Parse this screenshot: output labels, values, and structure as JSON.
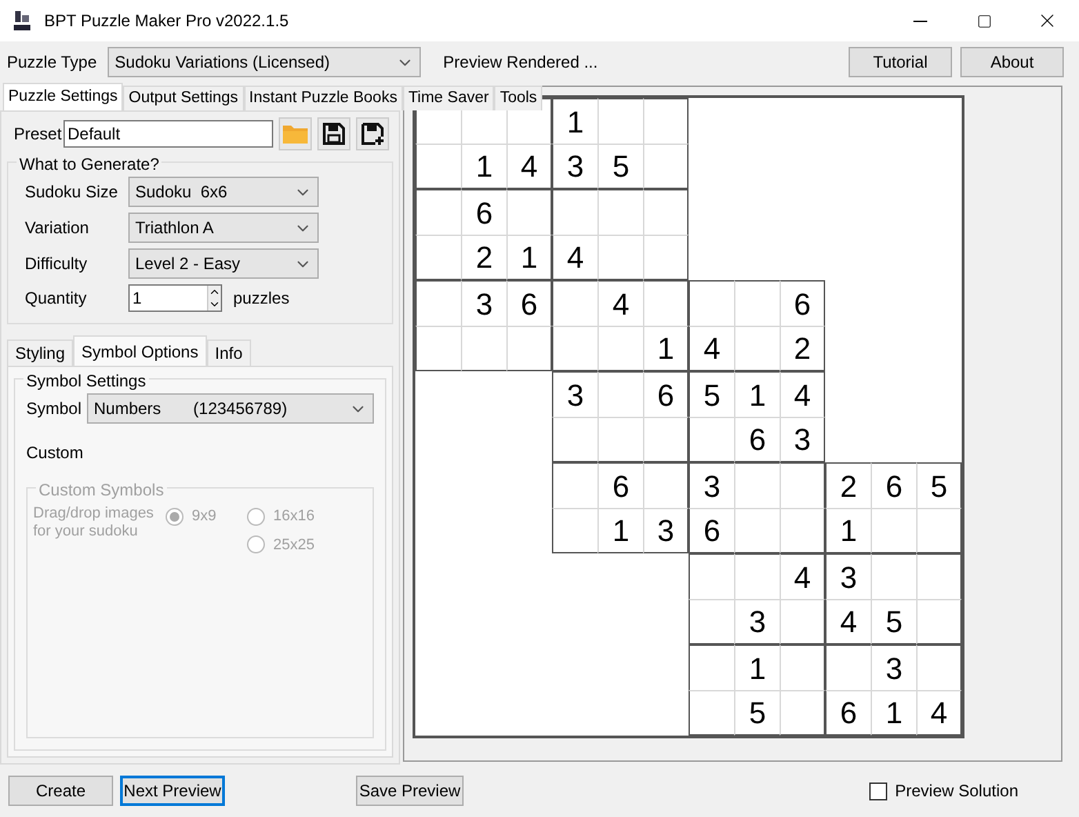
{
  "window": {
    "title": "BPT Puzzle Maker Pro v2022.1.5"
  },
  "toolbar": {
    "puzzle_type_label": "Puzzle Type",
    "puzzle_type": "Sudoku Variations (Licensed)",
    "status": "Preview Rendered ...",
    "buttons": [
      "Tutorial",
      "About"
    ]
  },
  "tabs": [
    {
      "label": "Puzzle Settings",
      "selected": true
    },
    {
      "label": "Output Settings",
      "selected": false
    },
    {
      "label": "Instant Puzzle Books",
      "selected": false
    },
    {
      "label": "Time Saver",
      "selected": false
    },
    {
      "label": "Tools",
      "selected": false
    }
  ],
  "preset": {
    "label": "Preset",
    "value": "Default"
  },
  "generate": {
    "title": "What to Generate?",
    "fields": [
      {
        "label": "Sudoku Size",
        "value": "Sudoku  6x6"
      },
      {
        "label": "Variation",
        "value": "Triathlon A"
      },
      {
        "label": "Difficulty",
        "value": "Level 2 - Easy"
      }
    ],
    "quantity": {
      "label": "Quantity",
      "value": "1",
      "unit": "puzzles"
    }
  },
  "sub_tabs": [
    {
      "label": "Styling",
      "selected": false
    },
    {
      "label": "Symbol Options",
      "selected": true
    },
    {
      "label": "Info",
      "selected": false
    }
  ],
  "symbol_settings": {
    "title": "Symbol Settings",
    "symbol_label": "Symbol",
    "symbol_value": "Numbers       (123456789)",
    "custom_label": "Custom"
  },
  "custom_symbols": {
    "title": "Custom Symbols",
    "disabled": true,
    "hint": "Drag/drop images for your sudoku",
    "options": [
      {
        "label": "9x9",
        "selected": true
      },
      {
        "label": "16x16",
        "selected": false
      },
      {
        "label": "25x25",
        "selected": false
      }
    ]
  },
  "board": {
    "rows": [
      [
        null,
        null,
        null,
        "1",
        null,
        null,
        null,
        null,
        null,
        null,
        null,
        null
      ],
      [
        null,
        "1",
        "4",
        "3",
        "5",
        null,
        null,
        null,
        null,
        null,
        null,
        null
      ],
      [
        null,
        "6",
        null,
        null,
        null,
        null,
        null,
        null,
        null,
        null,
        null,
        null
      ],
      [
        null,
        "2",
        "1",
        "4",
        null,
        null,
        null,
        null,
        null,
        null,
        null,
        null
      ],
      [
        null,
        "3",
        "6",
        null,
        "4",
        null,
        null,
        null,
        "6",
        null,
        null,
        null
      ],
      [
        null,
        null,
        null,
        null,
        null,
        "1",
        "4",
        null,
        "2",
        null,
        null,
        null
      ],
      [
        null,
        null,
        null,
        "3",
        null,
        "6",
        "5",
        "1",
        "4",
        null,
        null,
        null
      ],
      [
        null,
        null,
        null,
        null,
        null,
        null,
        null,
        "6",
        "3",
        null,
        null,
        null
      ],
      [
        null,
        null,
        null,
        null,
        "6",
        null,
        "3",
        null,
        null,
        "2",
        "6",
        "5"
      ],
      [
        null,
        null,
        null,
        null,
        "1",
        "3",
        "6",
        null,
        null,
        "1",
        null,
        null
      ],
      [
        null,
        null,
        null,
        null,
        null,
        null,
        null,
        null,
        "4",
        "3",
        null,
        null
      ],
      [
        null,
        null,
        null,
        null,
        null,
        null,
        null,
        "3",
        null,
        "4",
        "5",
        null
      ],
      [
        null,
        null,
        null,
        null,
        null,
        null,
        null,
        "1",
        null,
        null,
        "3",
        null
      ],
      [
        null,
        null,
        null,
        null,
        null,
        null,
        null,
        "5",
        null,
        "6",
        "1",
        "4"
      ]
    ]
  },
  "bottom": {
    "buttons": [
      {
        "label": "Create",
        "focused": false
      },
      {
        "label": "Next Preview",
        "focused": true
      }
    ],
    "save": "Save Preview",
    "preview_solution": {
      "label": "Preview Solution",
      "checked": false
    }
  }
}
